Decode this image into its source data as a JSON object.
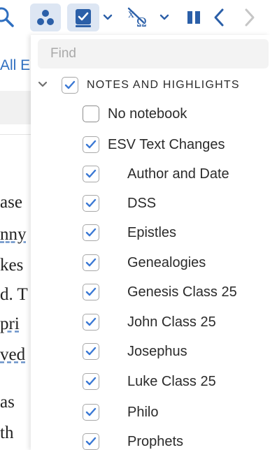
{
  "toolbar": {
    "icons": [
      "search-icon",
      "visual-filters-icon",
      "notes-highlights-icon",
      "chevron-down-icon",
      "interlinear-icon",
      "chevron-down-icon",
      "pause-icon",
      "back-icon",
      "forward-icon"
    ]
  },
  "document": {
    "link_text": "All E",
    "lines": [
      {
        "text": "ase"
      },
      {
        "text": "nny"
      },
      {
        "text": "kes"
      },
      {
        "text": "d. T"
      },
      {
        "text": "pri"
      },
      {
        "text": "ved"
      },
      {
        "text": "as"
      },
      {
        "text": "th"
      }
    ]
  },
  "panel": {
    "find_placeholder": "Find",
    "group": {
      "label": "NOTES AND HIGHLIGHTS",
      "checked": true
    },
    "items": [
      {
        "label": "No notebook",
        "checked": false
      },
      {
        "label": "ESV Text Changes",
        "checked": true
      },
      {
        "label": "Author and Date",
        "checked": true
      },
      {
        "label": "DSS",
        "checked": true
      },
      {
        "label": "Epistles",
        "checked": true
      },
      {
        "label": "Genealogies",
        "checked": true
      },
      {
        "label": "Genesis Class 25",
        "checked": true
      },
      {
        "label": "John Class 25",
        "checked": true
      },
      {
        "label": "Josephus",
        "checked": true
      },
      {
        "label": "Luke Class 25",
        "checked": true
      },
      {
        "label": "Philo",
        "checked": true
      },
      {
        "label": "Prophets",
        "checked": true
      }
    ]
  },
  "colors": {
    "accent": "#2f6fc0",
    "checkmark": "#3a78d4",
    "selected_tool_bg": "#dde6f3"
  }
}
